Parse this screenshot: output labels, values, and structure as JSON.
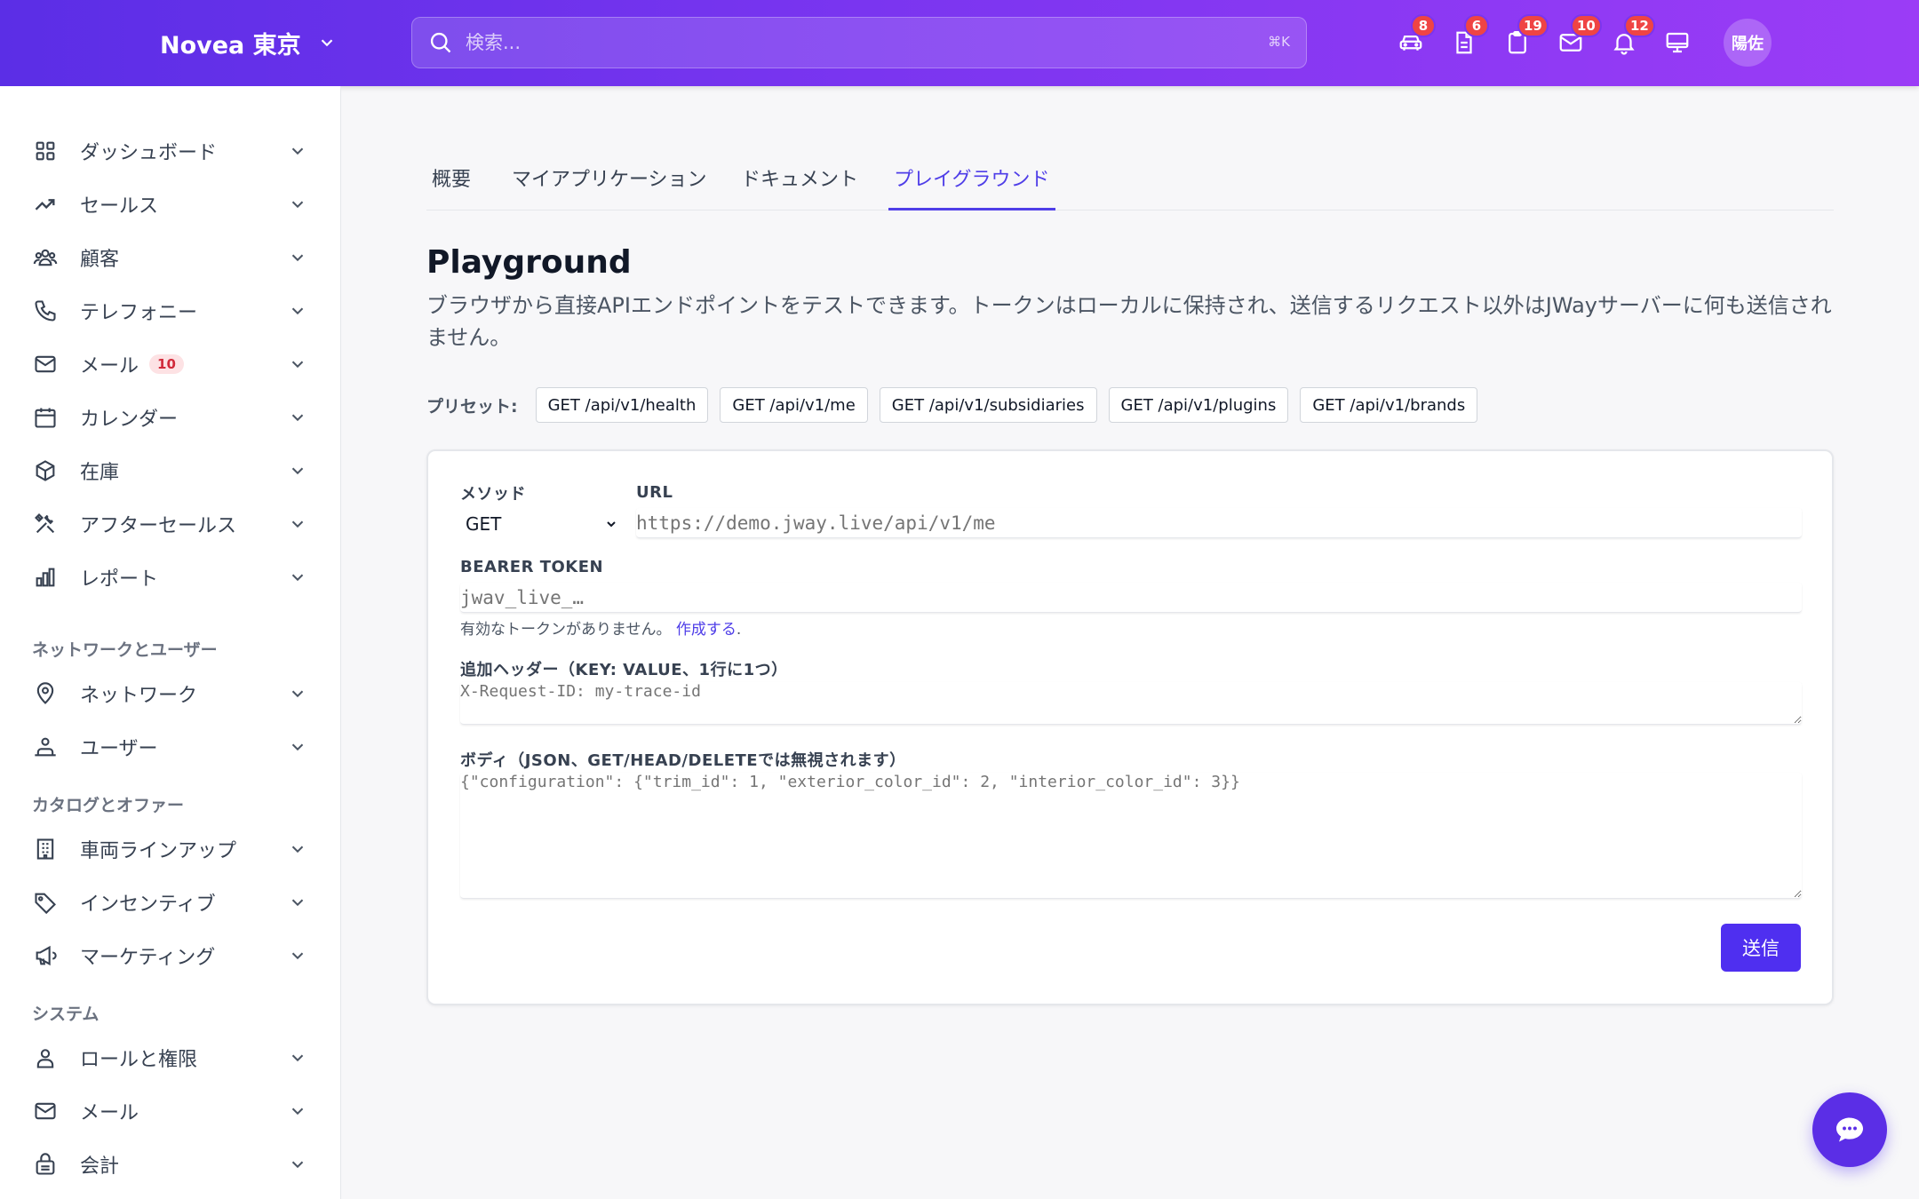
{
  "header": {
    "brand": "Novea 東京",
    "search_placeholder": "検索...",
    "search_shortcut": "⌘K",
    "icons": [
      {
        "name": "car-icon",
        "badge": "8"
      },
      {
        "name": "document-icon",
        "badge": "6"
      },
      {
        "name": "clipboard-icon",
        "badge": "19"
      },
      {
        "name": "mail-icon",
        "badge": "10"
      },
      {
        "name": "bell-icon",
        "badge": "12"
      },
      {
        "name": "monitor-icon",
        "badge": ""
      }
    ],
    "avatar": "陽佐"
  },
  "sidebar": {
    "items": [
      {
        "label": "ダッシュボード",
        "icon": "grid-icon"
      },
      {
        "label": "セールス",
        "icon": "trending-up-icon"
      },
      {
        "label": "顧客",
        "icon": "users-icon"
      },
      {
        "label": "テレフォニー",
        "icon": "phone-icon"
      },
      {
        "label": "メール",
        "icon": "mail-icon",
        "badge": "10"
      },
      {
        "label": "カレンダー",
        "icon": "calendar-icon"
      },
      {
        "label": "在庫",
        "icon": "box-icon"
      },
      {
        "label": "アフターセールス",
        "icon": "tools-icon"
      },
      {
        "label": "レポート",
        "icon": "bar-chart-icon"
      }
    ],
    "section_network": "ネットワークとユーザー",
    "network_items": [
      {
        "label": "ネットワーク",
        "icon": "location-icon"
      },
      {
        "label": "ユーザー",
        "icon": "user-group-icon"
      }
    ],
    "section_catalog": "カタログとオファー",
    "catalog_items": [
      {
        "label": "車両ラインアップ",
        "icon": "building-icon"
      },
      {
        "label": "インセンティブ",
        "icon": "tag-icon"
      },
      {
        "label": "マーケティング",
        "icon": "megaphone-icon"
      }
    ],
    "section_system": "システム",
    "system_items": [
      {
        "label": "ロールと権限",
        "icon": "user-icon"
      },
      {
        "label": "メール",
        "icon": "mail-icon"
      },
      {
        "label": "会計",
        "icon": "lock-bag-icon"
      }
    ]
  },
  "tabs": [
    "概要",
    "マイアプリケーション",
    "ドキュメント",
    "プレイグラウンド"
  ],
  "active_tab": "プレイグラウンド",
  "page": {
    "title": "Playground",
    "description": "ブラウザから直接APIエンドポイントをテストできます。トークンはローカルに保持され、送信するリクエスト以外はJWayサーバーに何も送信されません。"
  },
  "presets": {
    "label": "プリセット:",
    "buttons": [
      "GET /api/v1/health",
      "GET /api/v1/me",
      "GET /api/v1/subsidiaries",
      "GET /api/v1/plugins",
      "GET /api/v1/brands"
    ]
  },
  "form": {
    "method_label": "メソッド",
    "method_value": "GET",
    "url_label": "URL",
    "url_placeholder": "https://demo.jway.live/api/v1/me",
    "token_label": "BEARER TOKEN",
    "token_placeholder": "jwav_live_…",
    "token_hint": "有効なトークンがありません。",
    "token_hint_link": "作成する",
    "token_hint_end": ".",
    "headers_label": "追加ヘッダー（KEY: VALUE、1行に1つ）",
    "headers_placeholder": "X-Request-ID: my-trace-id",
    "body_label": "ボディ（JSON、GET/HEAD/DELETEでは無視されます）",
    "body_placeholder": "{\"configuration\": {\"trim_id\": 1, \"exterior_color_id\": 2, \"interior_color_id\": 3}}",
    "send_label": "送信"
  },
  "colors": {
    "accent": "#4f3ee8",
    "header_gradient_start": "#5b2ee6",
    "header_gradient_end": "#9b3cf6",
    "badge_red": "#ef4444"
  }
}
